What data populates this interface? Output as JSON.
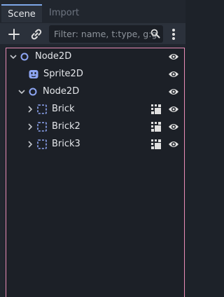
{
  "tabs": [
    {
      "label": "Scene",
      "active": true
    },
    {
      "label": "Import",
      "active": false
    }
  ],
  "toolbar": {
    "add_icon": "plus-icon",
    "link_icon": "link-icon",
    "filter_placeholder": "Filter: name, t:type, g:g",
    "filter_icon": "filter-search-icon",
    "menu_icon": "vertical-dots-icon"
  },
  "tree": [
    {
      "label": "Node2D",
      "type": "Node2D",
      "depth": 0,
      "arrow": "expanded",
      "script_icon": false
    },
    {
      "label": "Sprite2D",
      "type": "Sprite2D",
      "depth": 1,
      "arrow": "none",
      "script_icon": false
    },
    {
      "label": "Node2D",
      "type": "Node2D",
      "depth": 1,
      "arrow": "expanded",
      "script_icon": false
    },
    {
      "label": "Brick",
      "type": "Area2D",
      "depth": 2,
      "arrow": "collapsed",
      "script_icon": true
    },
    {
      "label": "Brick2",
      "type": "Area2D",
      "depth": 2,
      "arrow": "collapsed",
      "script_icon": true
    },
    {
      "label": "Brick3",
      "type": "Area2D",
      "depth": 2,
      "arrow": "collapsed",
      "script_icon": true
    }
  ],
  "colors": {
    "accent_blue": "#7ea7e8",
    "highlight_pink": "#e88bb5",
    "icon_purple": "#8ea6f4",
    "icon_white": "#e0e0e0"
  }
}
